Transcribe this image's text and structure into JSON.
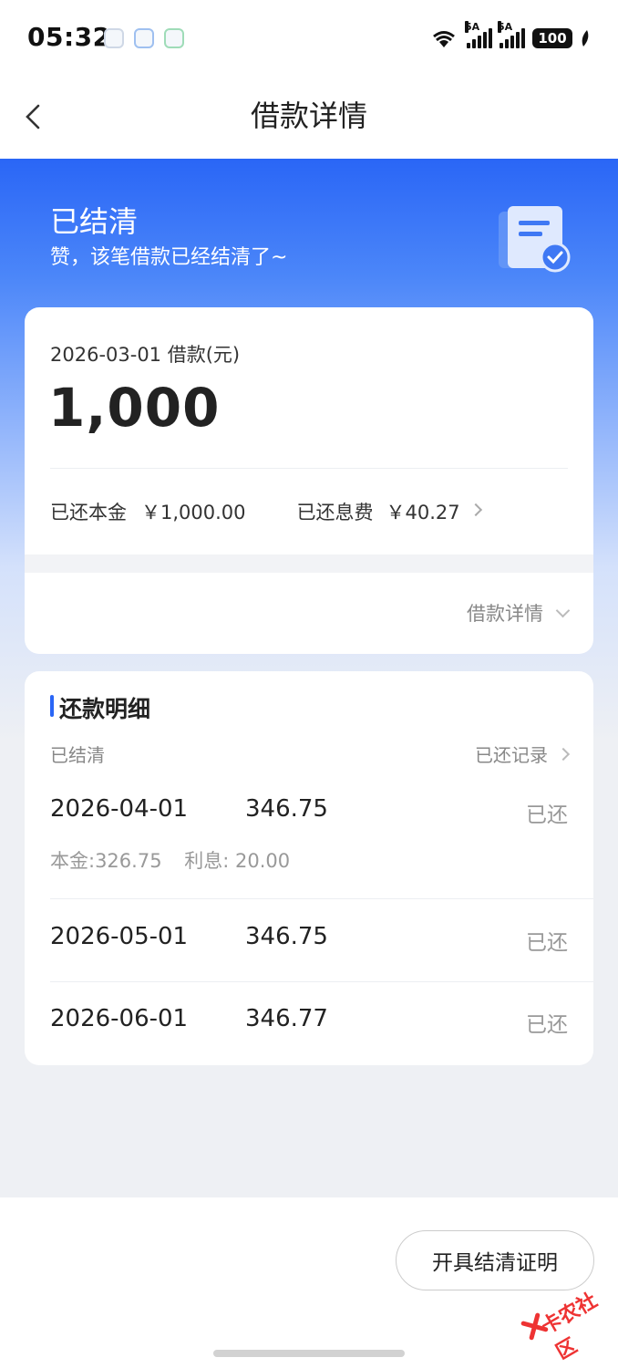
{
  "status_bar": {
    "time": "05:32",
    "network_1": "5A",
    "network_2": "5A",
    "wifi_label": "6",
    "battery": "100"
  },
  "nav": {
    "title": "借款详情"
  },
  "hero": {
    "status": "已结清",
    "subtitle": "赞，该笔借款已经结清了~"
  },
  "loan": {
    "date_label": "2026-03-01 借款(元)",
    "amount": "1,000",
    "repaid_principal_label": "已还本金",
    "repaid_principal_value": "￥1,000.00",
    "repaid_interest_label": "已还息费",
    "repaid_interest_value": "￥40.27",
    "detail_toggle": "借款详情"
  },
  "repayment": {
    "title": "还款明细",
    "settled_tag": "已结清",
    "records_link": "已还记录",
    "plans": [
      {
        "date": "2026-04-01",
        "amount": "346.75",
        "status": "已还",
        "principal": "本金:326.75",
        "interest": "利息: 20.00"
      },
      {
        "date": "2026-05-01",
        "amount": "346.75",
        "status": "已还"
      },
      {
        "date": "2026-06-01",
        "amount": "346.77",
        "status": "已还"
      }
    ]
  },
  "footer": {
    "cert_button": "开具结清证明"
  },
  "watermark": "卡农社区",
  "colors": {
    "primary": "#2a66f6",
    "bg": "#eef0f4",
    "muted": "#999999"
  }
}
